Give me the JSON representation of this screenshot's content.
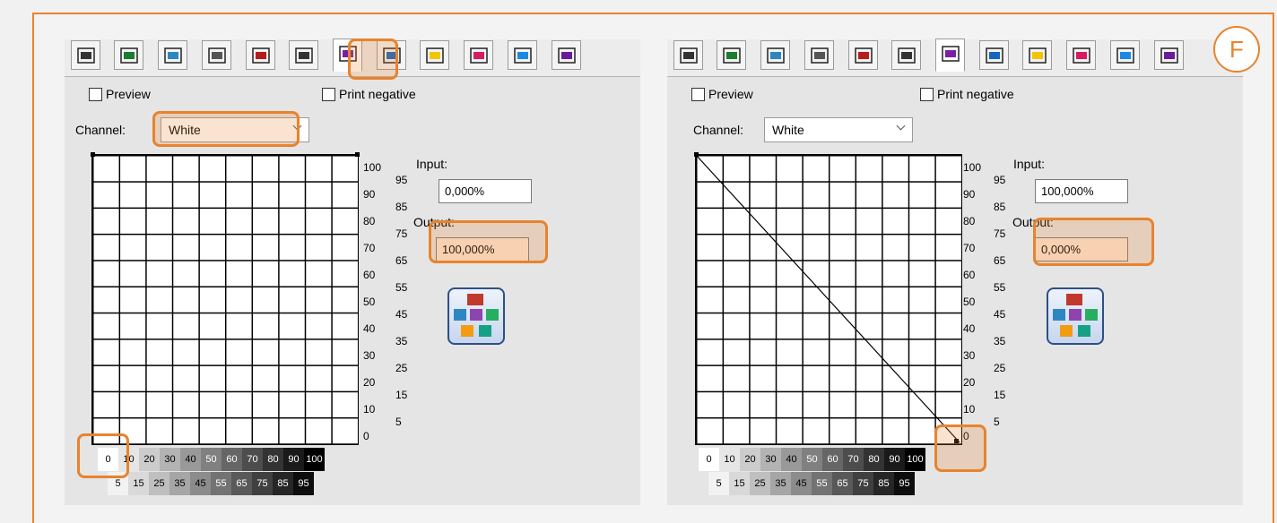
{
  "panels": [
    {
      "preview_label": "Preview",
      "print_negative_label": "Print negative",
      "channel_label": "Channel:",
      "channel_value": "White",
      "input_label": "Input:",
      "input_value": "0,000%",
      "output_label": "Output:",
      "output_value": "100,000%"
    },
    {
      "preview_label": "Preview",
      "print_negative_label": "Print negative",
      "channel_label": "Channel:",
      "channel_value": "White",
      "input_label": "Input:",
      "input_value": "100,000%",
      "output_label": "Output:",
      "output_value": "0,000%"
    }
  ],
  "y_ticks_major": [
    "100",
    "90",
    "80",
    "70",
    "60",
    "50",
    "40",
    "30",
    "20",
    "10",
    "0"
  ],
  "y_ticks_minor": [
    "95",
    "85",
    "75",
    "65",
    "55",
    "45",
    "35",
    "25",
    "15",
    "5"
  ],
  "scale_top": [
    "0",
    "10",
    "20",
    "30",
    "40",
    "50",
    "60",
    "70",
    "80",
    "90",
    "100"
  ],
  "scale_bottom": [
    "5",
    "15",
    "25",
    "35",
    "45",
    "55",
    "65",
    "75",
    "85",
    "95"
  ],
  "tab_icons": [
    "printer-icon",
    "document-arrow-icon",
    "color-document-icon",
    "print-head-icon",
    "crop-marks-icon",
    "target-icon",
    "curves-icon",
    "layers-icon",
    "cmy-overlap-icon",
    "bars-icon",
    "triangle-icon",
    "eyedropper-icon"
  ],
  "active_tab_index": 6,
  "badge": "F",
  "colors": {
    "highlight": "#e8832e",
    "curve_line": "#000000",
    "wheel_border": "#2e4f86"
  }
}
